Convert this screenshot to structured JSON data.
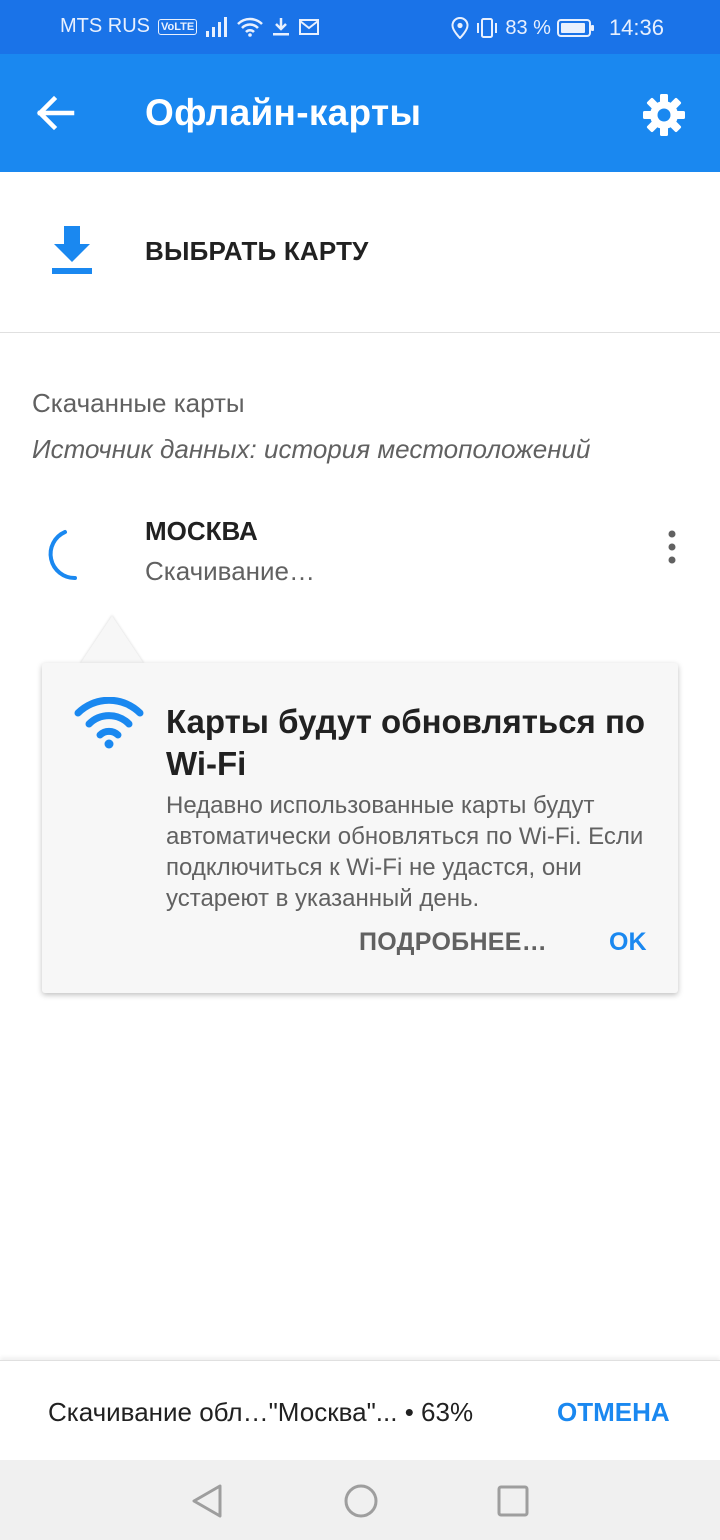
{
  "status_bar": {
    "carrier": "MTS RUS",
    "volte": "VoLTE",
    "battery": "83 %",
    "time": "14:36"
  },
  "app_bar": {
    "title": "Офлайн-карты",
    "back_icon": "arrow-left-icon",
    "settings_icon": "gear-icon"
  },
  "choose_map": {
    "label": "ВЫБРАТЬ КАРТУ",
    "icon": "download-icon"
  },
  "downloaded": {
    "title": "Скачанные карты",
    "subtitle": "Источник данных: история местоположений",
    "items": [
      {
        "name": "МОСКВА",
        "status": "Скачивание…"
      }
    ]
  },
  "tooltip": {
    "title": "Карты будут обновляться по Wi-Fi",
    "body": "Недавно использованные карты будут автоматически обновляться по Wi-Fi. Если подключиться к Wi-Fi не удастся, они устареют в указанный день.",
    "more_label": "ПОДРОБНЕЕ…",
    "ok_label": "OK"
  },
  "download_bar": {
    "text": "Скачивание обл…\"Москва\"... • 63%",
    "cancel_label": "ОТМЕНА"
  },
  "colors": {
    "status_bar": "#1a73e8",
    "app_bar": "#1a88f0",
    "accent": "#1a88f0"
  }
}
